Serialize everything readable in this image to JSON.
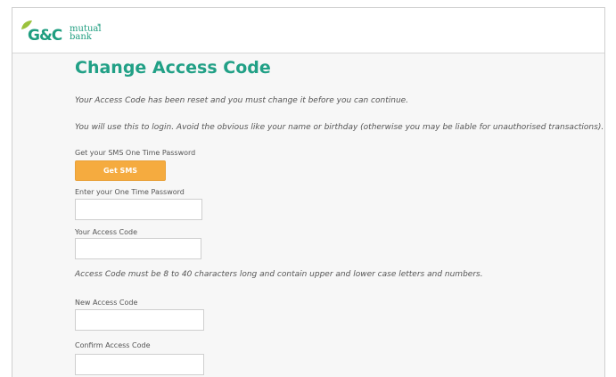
{
  "brand": {
    "name": "G&C",
    "mutual_line1": "mutual",
    "mutual_line2": "bank",
    "star": "*",
    "primary_color": "#21a086",
    "button_color": "#f5ab3f"
  },
  "page": {
    "title": "Change Access Code",
    "intro": "Your Access Code has been reset and you must change it before you can continue.",
    "advice": "You will use this to login. Avoid the obvious like your name or birthday (otherwise you may be liable for unauthorised transactions).",
    "rules": "Access Code must be 8 to 40 characters long and contain upper and lower case letters and numbers."
  },
  "form": {
    "sms_label": "Get your SMS One Time Password",
    "sms_button": "Get SMS",
    "otp_label": "Enter your One Time Password",
    "otp_value": "",
    "current_label": "Your Access Code",
    "current_value": "",
    "new_label": "New Access Code",
    "new_value": "",
    "confirm_label": "Confirm Access Code",
    "confirm_value": ""
  }
}
